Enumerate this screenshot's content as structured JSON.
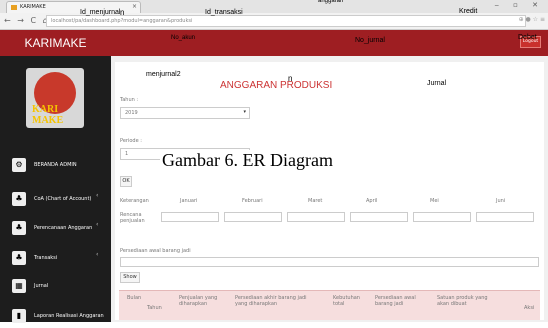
{
  "browser": {
    "tab_title": "KARIMAKE",
    "tab_close": "×",
    "window_controls": "‒ ▫ ✕",
    "nav_glyphs": "← → C ⌂",
    "url": "localhost/pa/dashboard.php?modul=anggaran&produksi",
    "browser_icons": "⊕ ● ☆ ≡"
  },
  "overlay": {
    "anggaran": "anggaran",
    "id_menjurnal": "Id_menjurnal",
    "n": "n",
    "id_transaksi": "Id_transaksi",
    "kredit": "Kredit",
    "no_akun": "No_akun",
    "no_jurnal": "No_jurnal",
    "debet": "Debet",
    "menjurnal2": "menjurnal2",
    "n2": "n",
    "jurnal": "Jurnal",
    "caption": "Gambar 6. ER Diagram"
  },
  "sidebar": {
    "brand": "KARIMAKE",
    "logo_text": "KARI MAKE",
    "items": [
      {
        "label": "BERANDA ADMIN",
        "icon": "dashboard-icon",
        "glyph": "⚙",
        "arrow": ""
      },
      {
        "label": "CoA (Chart of Account)",
        "icon": "sitemap-icon",
        "glyph": "♣",
        "arrow": "‹"
      },
      {
        "label": "Perencanaan Anggaran",
        "icon": "sitemap-icon",
        "glyph": "♣",
        "arrow": "‹"
      },
      {
        "label": "Transaksi",
        "icon": "sitemap-icon",
        "glyph": "♣",
        "arrow": "‹"
      },
      {
        "label": "Jurnal",
        "icon": "qrcode-icon",
        "glyph": "▦",
        "arrow": ""
      },
      {
        "label": "Laporan Realisasi Anggaran",
        "icon": "chart-icon",
        "glyph": "▮",
        "arrow": ""
      }
    ]
  },
  "header": {
    "logout": "Logout"
  },
  "content": {
    "title": "ANGGARAN PRODUKSI",
    "tahun_label": "Tahun :",
    "tahun_value": "2019",
    "periode_label": "Periode :",
    "periode_value": "1",
    "ok_button": "OK",
    "month_headers": [
      "Keterangan",
      "Januari",
      "Februari",
      "Maret",
      "April",
      "Mei",
      "Juni"
    ],
    "rencana_label": "Rencana penjualan",
    "persediaan_label": "Persediaan awal barang jadi",
    "show_button": "Show",
    "table_headers": [
      "Bulan",
      "Tahun",
      "Penjualan yang diharapkan",
      "Persediaan akhir barang jadi yang diharapkan",
      "Kebutuhan total",
      "Persediaan awal barang jadi",
      "Satuan produk yang akan dibuat",
      "Aksi"
    ]
  }
}
